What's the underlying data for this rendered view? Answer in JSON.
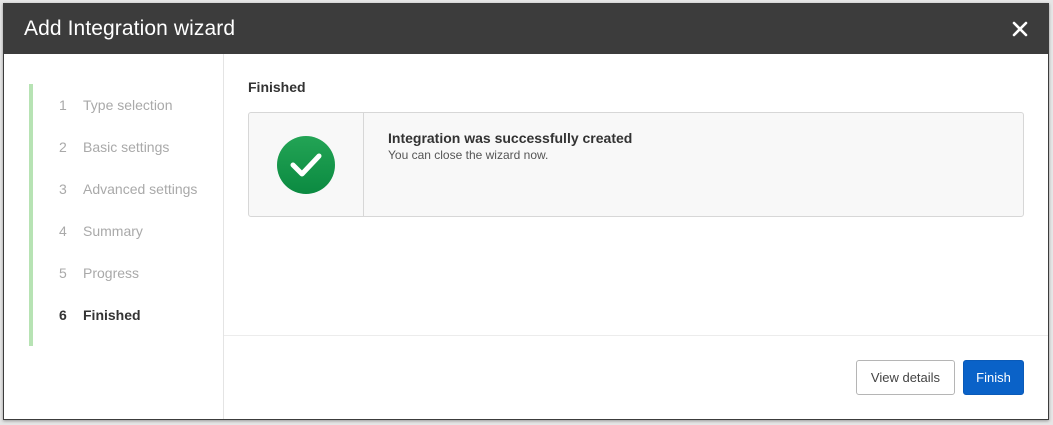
{
  "dialog": {
    "title": "Add Integration wizard",
    "close_icon": "close-icon"
  },
  "steps": [
    {
      "num": "1",
      "label": "Type selection",
      "active": false
    },
    {
      "num": "2",
      "label": "Basic settings",
      "active": false
    },
    {
      "num": "3",
      "label": "Advanced settings",
      "active": false
    },
    {
      "num": "4",
      "label": "Summary",
      "active": false
    },
    {
      "num": "5",
      "label": "Progress",
      "active": false
    },
    {
      "num": "6",
      "label": "Finished",
      "active": true
    }
  ],
  "main": {
    "section_title": "Finished",
    "result": {
      "icon": "check-circle-icon",
      "title": "Integration was successfully created",
      "subtitle": "You can close the wizard now."
    }
  },
  "footer": {
    "view_details_label": "View details",
    "finish_label": "Finish"
  },
  "colors": {
    "titlebar": "#3c3c3c",
    "step_indicator": "#b7e3b4",
    "success": "#1a9a4e",
    "primary_button": "#0a62c8"
  }
}
